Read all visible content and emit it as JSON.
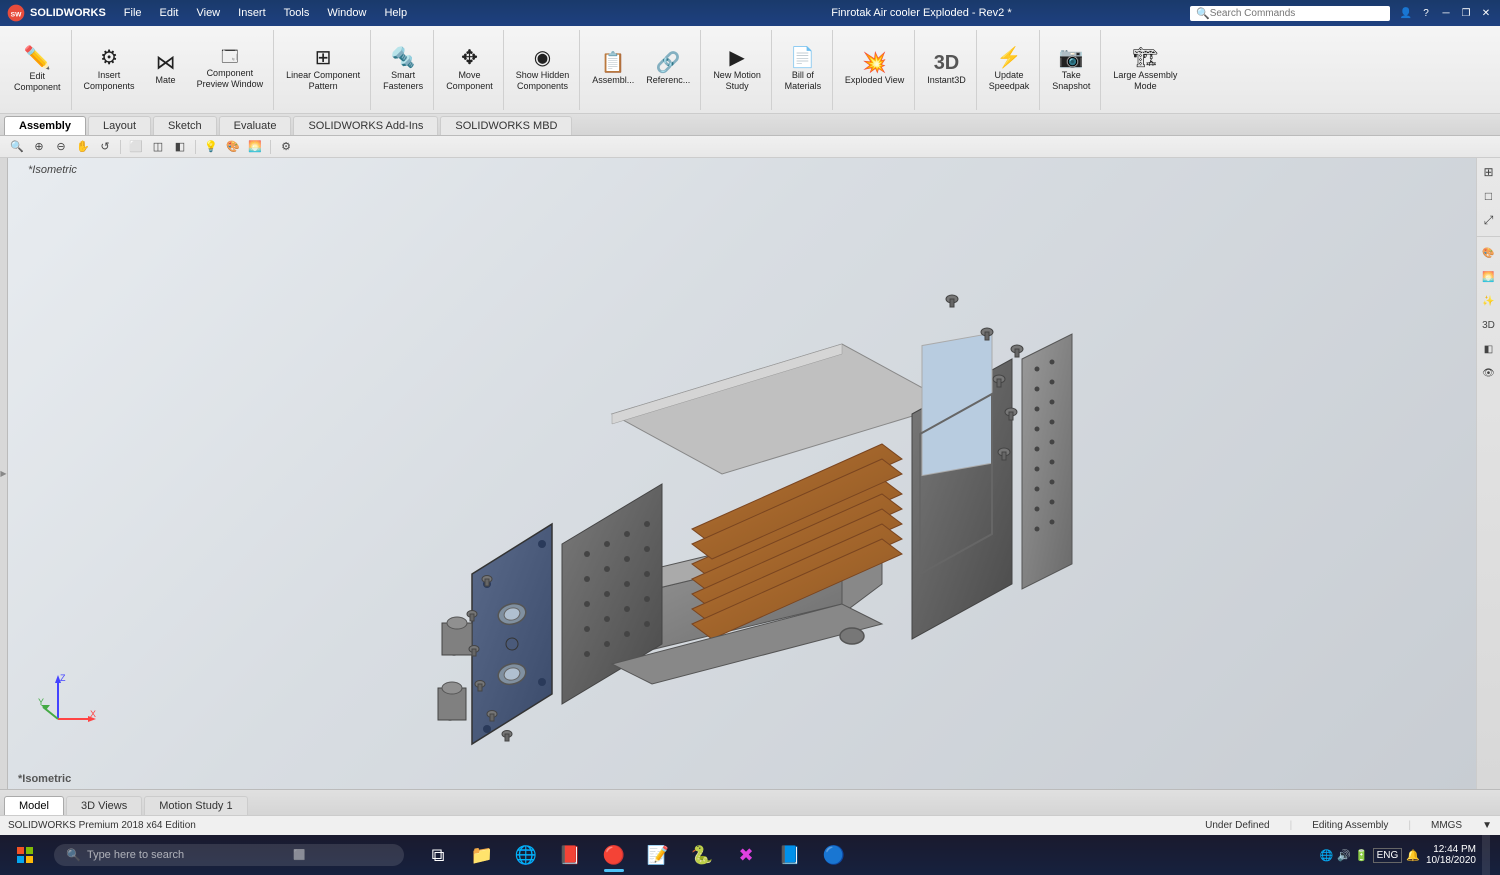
{
  "titlebar": {
    "logo": "SOLIDWORKS",
    "menu": [
      "File",
      "Edit",
      "View",
      "Insert",
      "Tools",
      "Window",
      "Help"
    ],
    "title": "Finrotak Air cooler Exploded - Rev2 *",
    "search_placeholder": "Search Commands",
    "controls": [
      "minimize",
      "restore",
      "close"
    ]
  },
  "toolbar": {
    "buttons": [
      {
        "id": "edit-component",
        "icon": "✏️",
        "label": "Edit\nComponent"
      },
      {
        "id": "insert-components",
        "icon": "⚙️",
        "label": "Insert\nComponents"
      },
      {
        "id": "mate",
        "icon": "🔗",
        "label": "Mate"
      },
      {
        "id": "component-preview",
        "icon": "👁️",
        "label": "Component\nPreview Window"
      },
      {
        "id": "linear-component-pattern",
        "icon": "⊞",
        "label": "Linear Component\nPattern"
      },
      {
        "id": "smart-fasteners",
        "icon": "🔩",
        "label": "Smart\nFasteners"
      },
      {
        "id": "move-component",
        "icon": "↔️",
        "label": "Move\nComponent"
      },
      {
        "id": "show-hidden-components",
        "icon": "◉",
        "label": "Show Hidden\nComponents"
      },
      {
        "id": "assembly-study",
        "icon": "📋",
        "label": "Assembl..."
      },
      {
        "id": "references",
        "icon": "🔗",
        "label": "Referenc..."
      },
      {
        "id": "new-motion-study",
        "icon": "▶️",
        "label": "New Motion\nStudy"
      },
      {
        "id": "bill-of-materials",
        "icon": "📄",
        "label": "Bill of\nMaterials"
      },
      {
        "id": "exploded-view",
        "icon": "💥",
        "label": "Exploded View"
      },
      {
        "id": "instant3d",
        "icon": "3️⃣",
        "label": "Instant3D"
      },
      {
        "id": "update-speedpak",
        "icon": "⚡",
        "label": "Update\nSpeedpak"
      },
      {
        "id": "take-snapshot",
        "icon": "📷",
        "label": "Take\nSnapshot"
      },
      {
        "id": "large-assembly-mode",
        "icon": "🏗️",
        "label": "Large Assembly\nMode"
      }
    ]
  },
  "tabs": {
    "main": [
      "Assembly",
      "Layout",
      "Sketch",
      "Evaluate",
      "SOLIDWORKS Add-Ins",
      "SOLIDWORKS MBD"
    ],
    "active_main": "Assembly"
  },
  "bottom_tabs": {
    "items": [
      "Model",
      "3D Views",
      "Motion Study 1"
    ],
    "active": "Model"
  },
  "statusbar": {
    "edition": "SOLIDWORKS Premium 2018 x64 Edition",
    "status": "Under Defined",
    "mode": "Editing Assembly",
    "units": "MMGS",
    "sep": "▼"
  },
  "viewport": {
    "view_label": "*Isometric",
    "model_title": "Finrotak Air cooler Exploded - Rev2"
  },
  "taskbar": {
    "search_placeholder": "Type here to search",
    "apps": [
      {
        "id": "task-view",
        "icon": "⧉",
        "active": false
      },
      {
        "id": "file-explorer",
        "icon": "📁",
        "active": false
      },
      {
        "id": "chrome",
        "icon": "🌐",
        "active": false
      },
      {
        "id": "acrobat",
        "icon": "📕",
        "active": false
      },
      {
        "id": "solidworks",
        "icon": "🔴",
        "active": true
      },
      {
        "id": "sticky",
        "icon": "📝",
        "active": false
      },
      {
        "id": "pycharm",
        "icon": "🐍",
        "active": false
      },
      {
        "id": "xmind",
        "icon": "✖️",
        "active": false
      },
      {
        "id": "word",
        "icon": "📘",
        "active": false
      },
      {
        "id": "app9",
        "icon": "🔵",
        "active": false
      }
    ],
    "time": "12:44 PM",
    "date": "10/18/2020",
    "tray": [
      "🔔",
      "🔊",
      "ENG",
      "🌐"
    ]
  }
}
